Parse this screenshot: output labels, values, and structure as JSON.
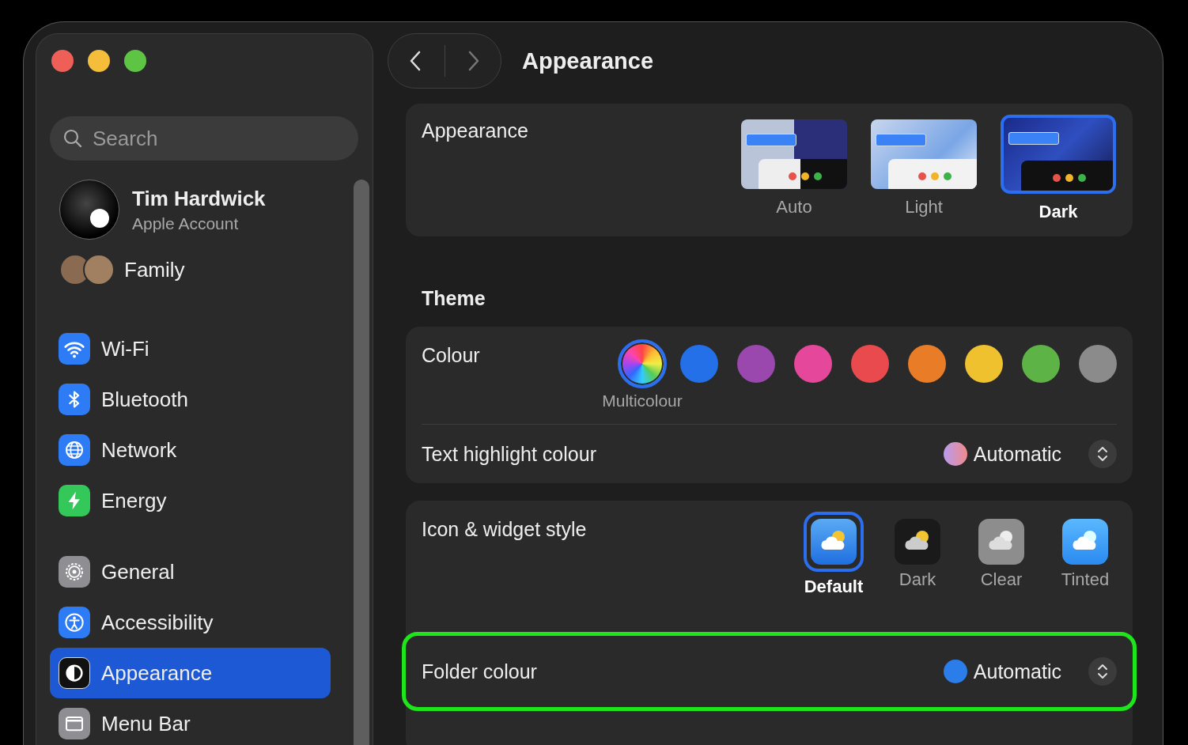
{
  "sidebar": {
    "search": {
      "placeholder": "Search"
    },
    "account": {
      "name": "Tim Hardwick",
      "subtitle": "Apple Account"
    },
    "family": {
      "label": "Family"
    },
    "groups": [
      [
        {
          "label": "Wi-Fi",
          "kind": "wifi",
          "selected": false
        },
        {
          "label": "Bluetooth",
          "kind": "bluetooth",
          "selected": false
        },
        {
          "label": "Network",
          "kind": "network",
          "selected": false
        },
        {
          "label": "Energy",
          "kind": "energy",
          "selected": false
        }
      ],
      [
        {
          "label": "General",
          "kind": "general",
          "selected": false
        },
        {
          "label": "Accessibility",
          "kind": "accessibility",
          "selected": false
        },
        {
          "label": "Appearance",
          "kind": "appearance",
          "selected": true
        },
        {
          "label": "Menu Bar",
          "kind": "menubar",
          "selected": false
        }
      ]
    ]
  },
  "main": {
    "title": "Appearance",
    "appearance": {
      "label": "Appearance",
      "options": [
        {
          "label": "Auto",
          "kind": "auto",
          "selected": false
        },
        {
          "label": "Light",
          "kind": "light",
          "selected": false
        },
        {
          "label": "Dark",
          "kind": "dark",
          "selected": true
        }
      ]
    },
    "theme": {
      "heading": "Theme",
      "colour_label": "Colour",
      "swatches": [
        {
          "kind": "multicolour",
          "name": "Multicolour",
          "selected": true
        },
        {
          "kind": "solid",
          "color": "#2470e8",
          "selected": false
        },
        {
          "kind": "solid",
          "color": "#9a47ae",
          "selected": false
        },
        {
          "kind": "solid",
          "color": "#e5489b",
          "selected": false
        },
        {
          "kind": "solid",
          "color": "#e84a4d",
          "selected": false
        },
        {
          "kind": "solid",
          "color": "#e97d27",
          "selected": false
        },
        {
          "kind": "solid",
          "color": "#f0c12f",
          "selected": false
        },
        {
          "kind": "solid",
          "color": "#5db346",
          "selected": false
        },
        {
          "kind": "solid",
          "color": "#8b8b8b",
          "selected": false
        }
      ],
      "highlight": {
        "label": "Text highlight colour",
        "value": "Automatic"
      }
    },
    "icon_style": {
      "label": "Icon & widget style",
      "options": [
        {
          "label": "Default",
          "kind": "default",
          "selected": true
        },
        {
          "label": "Dark",
          "kind": "dark",
          "selected": false
        },
        {
          "label": "Clear",
          "kind": "clear",
          "selected": false
        },
        {
          "label": "Tinted",
          "kind": "tinted",
          "selected": false
        }
      ]
    },
    "folder": {
      "label": "Folder colour",
      "value": "Automatic",
      "color": "#2b7de9",
      "highlighted": true
    }
  }
}
